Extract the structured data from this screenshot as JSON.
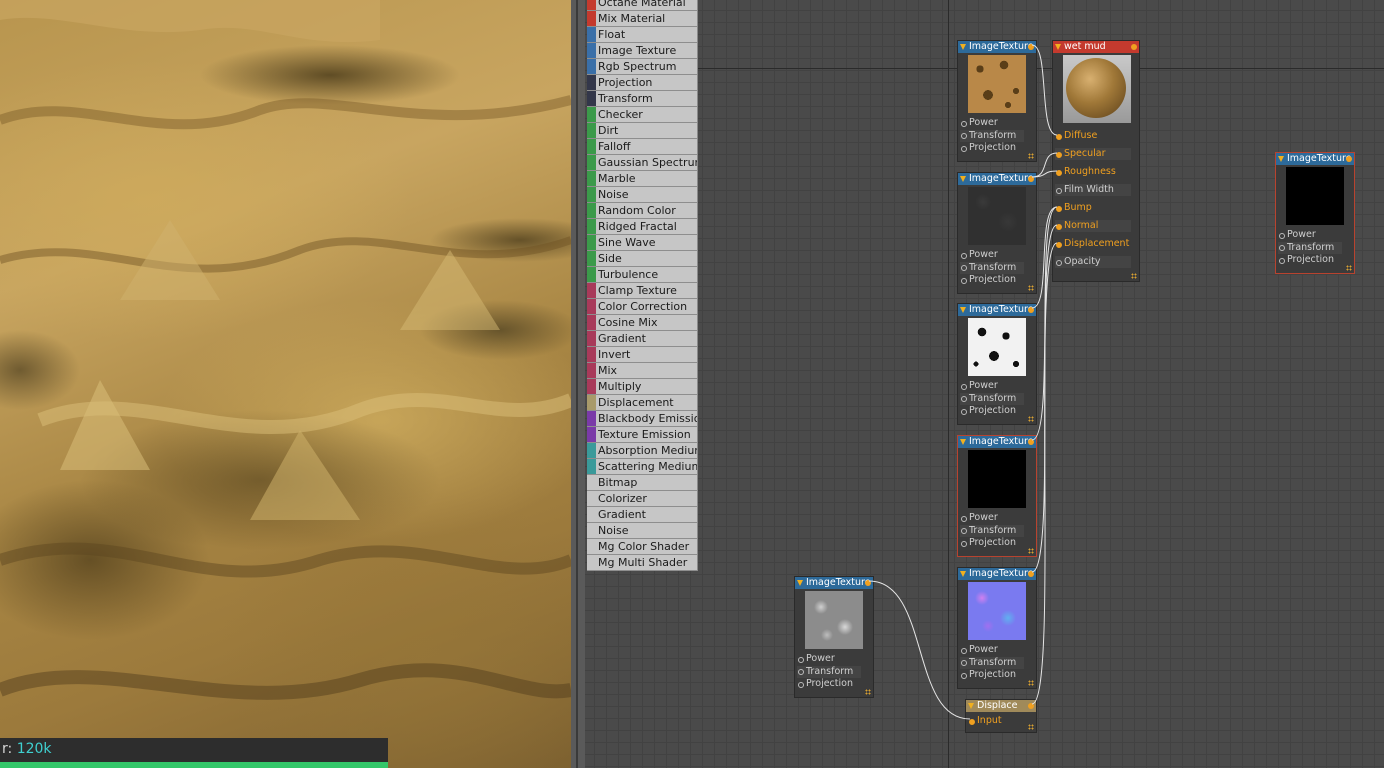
{
  "render": {
    "status_label": "r: ",
    "status_value": "120k",
    "progress": 1.0,
    "progress_color": "#34c76a"
  },
  "palette": {
    "items": [
      {
        "label": "Octane Material",
        "color": "#c43a2e"
      },
      {
        "label": "Mix Material",
        "color": "#c43a2e"
      },
      {
        "label": "Float",
        "color": "#3a6fa8"
      },
      {
        "label": "Image Texture",
        "color": "#3a6fa8"
      },
      {
        "label": "Rgb Spectrum",
        "color": "#3a6fa8"
      },
      {
        "label": "Projection",
        "color": "#33374a"
      },
      {
        "label": "Transform",
        "color": "#33374a"
      },
      {
        "label": "Checker",
        "color": "#3b9a4a"
      },
      {
        "label": "Dirt",
        "color": "#3b9a4a"
      },
      {
        "label": "Falloff",
        "color": "#3b9a4a"
      },
      {
        "label": "Gaussian Spectrum",
        "color": "#3b9a4a"
      },
      {
        "label": "Marble",
        "color": "#3b9a4a"
      },
      {
        "label": "Noise",
        "color": "#3b9a4a"
      },
      {
        "label": "Random Color",
        "color": "#3b9a4a"
      },
      {
        "label": "Ridged Fractal",
        "color": "#3b9a4a"
      },
      {
        "label": "Sine Wave",
        "color": "#3b9a4a"
      },
      {
        "label": "Side",
        "color": "#3b9a4a"
      },
      {
        "label": "Turbulence",
        "color": "#3b9a4a"
      },
      {
        "label": "Clamp Texture",
        "color": "#a83a5a"
      },
      {
        "label": "Color Correction",
        "color": "#a83a5a"
      },
      {
        "label": "Cosine Mix",
        "color": "#a83a5a"
      },
      {
        "label": "Gradient",
        "color": "#a83a5a"
      },
      {
        "label": "Invert",
        "color": "#a83a5a"
      },
      {
        "label": "Mix",
        "color": "#a83a5a"
      },
      {
        "label": "Multiply",
        "color": "#a83a5a"
      },
      {
        "label": "Displacement",
        "color": "#a89a6a"
      },
      {
        "label": "Blackbody Emission",
        "color": "#7a3aa8"
      },
      {
        "label": "Texture Emission",
        "color": "#7a3aa8"
      },
      {
        "label": "Absorption Medium",
        "color": "#3a9a9a"
      },
      {
        "label": "Scattering Medium",
        "color": "#3a9a9a"
      },
      {
        "label": "Bitmap",
        "color": "#c6c6c6"
      },
      {
        "label": "Colorizer",
        "color": "#c6c6c6"
      },
      {
        "label": "Gradient",
        "color": "#c6c6c6"
      },
      {
        "label": "Noise",
        "color": "#c6c6c6"
      },
      {
        "label": "Mg Color Shader",
        "color": "#c6c6c6"
      },
      {
        "label": "Mg Multi Shader",
        "color": "#c6c6c6"
      }
    ]
  },
  "tex_inputs": [
    "Power",
    "Transform",
    "Projection"
  ],
  "nodes": {
    "tex_diffuse": {
      "title": "ImageTexture",
      "texture": "mud-texture"
    },
    "tex_roughness": {
      "title": "ImageTexture",
      "texture": "rough-texture"
    },
    "tex_bump": {
      "title": "ImageTexture",
      "texture": "bw-texture"
    },
    "tex_black_center": {
      "title": "ImageTexture",
      "texture": "black-texture"
    },
    "tex_normal": {
      "title": "ImageTexture",
      "texture": "normal-texture"
    },
    "tex_displace_src": {
      "title": "ImageTexture",
      "texture": "gray-texture"
    },
    "tex_black_right": {
      "title": "ImageTexture",
      "texture": "black-texture"
    },
    "displace": {
      "title": "Displace",
      "input": "Input"
    },
    "material": {
      "title": "wet mud",
      "inputs": [
        "Diffuse",
        "Specular",
        "Roughness",
        "Film Width",
        "Bump",
        "Normal",
        "Displacement",
        "Opacity"
      ],
      "active": [
        true,
        true,
        true,
        false,
        true,
        true,
        true,
        false
      ]
    }
  },
  "colors": {
    "texture_header": "#2d6a9a",
    "material_header": "#c43a2e",
    "displace_header": "#a08a5a",
    "link": "#e6e6e6",
    "pin_active": "#f0a020"
  }
}
